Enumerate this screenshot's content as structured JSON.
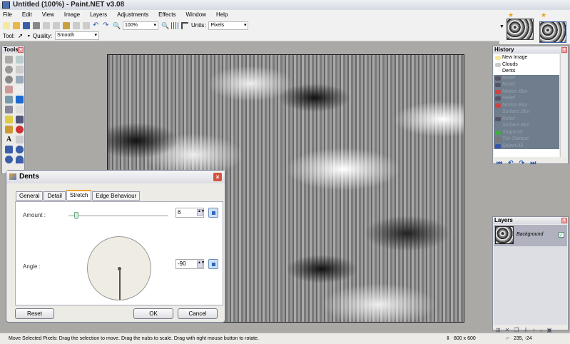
{
  "window": {
    "title": "Untitled (100%) - Paint.NET v3.08"
  },
  "menu": [
    "File",
    "Edit",
    "View",
    "Image",
    "Layers",
    "Adjustments",
    "Effects",
    "Window",
    "Help"
  ],
  "toolbar": {
    "zoom": "100%",
    "units_label": "Units:",
    "units": "Pixels",
    "tool_label": "Tool:",
    "quality_label": "Quality:",
    "quality": "Smooth"
  },
  "tools": {
    "title": "Tools"
  },
  "history": {
    "title": "History",
    "items": [
      {
        "label": "New Image",
        "undone": false
      },
      {
        "label": "Clouds",
        "undone": false
      },
      {
        "label": "Dents",
        "undone": false
      },
      {
        "label": "Relief",
        "undone": true
      },
      {
        "label": "Relief",
        "undone": true
      },
      {
        "label": "Motion Blur",
        "undone": true
      },
      {
        "label": "Relief",
        "undone": true
      },
      {
        "label": "Motion Blur",
        "undone": true
      },
      {
        "label": "Surface Blur",
        "undone": true
      },
      {
        "label": "Relief",
        "undone": true
      },
      {
        "label": "Surface Blur",
        "undone": true
      },
      {
        "label": "Shape3D",
        "undone": true
      },
      {
        "label": "Tile Oblique",
        "undone": true
      },
      {
        "label": "Select All",
        "undone": true
      }
    ]
  },
  "layers": {
    "title": "Layers",
    "items": [
      {
        "name": "Background",
        "visible": true
      }
    ]
  },
  "dialog": {
    "title": "Dents",
    "tabs": [
      "General",
      "Detail",
      "Stretch",
      "Edge Behaviour"
    ],
    "active_tab": "Stretch",
    "amount_label": "Amount :",
    "amount": "6",
    "angle_label": "Angle :",
    "angle": "-90",
    "reset": "Reset",
    "ok": "OK",
    "cancel": "Cancel"
  },
  "status": {
    "message": "Move Selected Pixels: Drag the selection to move. Drag the nubs to scale. Drag with right mouse button to rotate.",
    "image_size": "800 x 600",
    "cursor": "235, -24"
  }
}
